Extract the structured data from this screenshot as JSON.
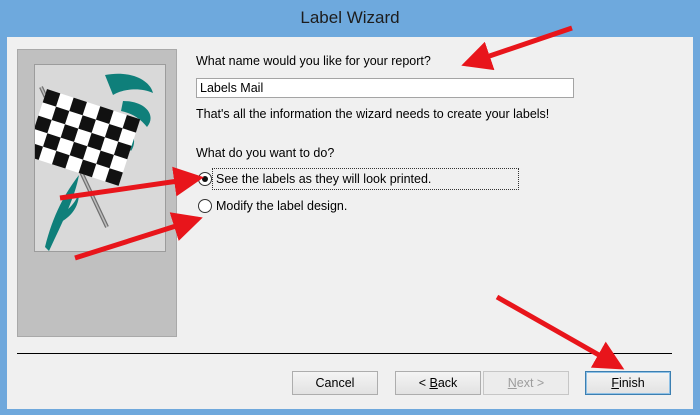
{
  "window": {
    "title": "Label Wizard"
  },
  "question_name": "What name would you like for your report?",
  "report_name_value": "Labels Mail",
  "info_text": "That's all the information the wizard needs to create your labels!",
  "question_do": "What do you want to do?",
  "options": [
    {
      "label": "See the labels as they will look printed.",
      "selected": true
    },
    {
      "label": "Modify the label design.",
      "selected": false
    }
  ],
  "buttons": {
    "cancel": "Cancel",
    "back_prefix": "< ",
    "back_ul": "B",
    "back_rest": "ack",
    "next_prefix": "",
    "next_ul": "N",
    "next_rest": "ext >",
    "finish_ul": "F",
    "finish_rest": "inish"
  },
  "colors": {
    "titlebar": "#6ea9dd",
    "annotation_arrow": "#e8151b",
    "flag_swoosh": "#0f7f7a"
  },
  "icons": [
    "checkered-flag-icon",
    "red-arrow-annotation"
  ]
}
